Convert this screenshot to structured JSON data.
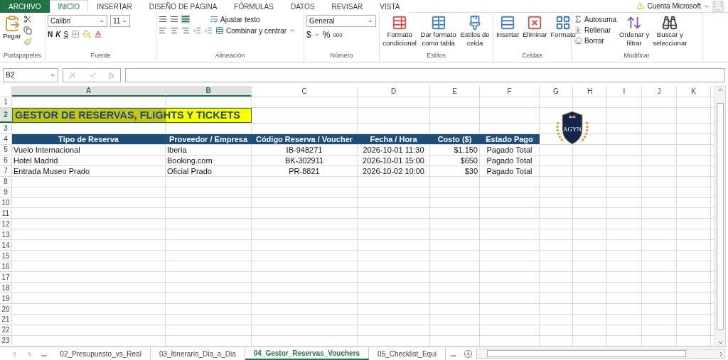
{
  "ribbon_tabs": [
    {
      "label": "ARCHIVO",
      "kind": "file",
      "selected": false
    },
    {
      "label": "INICIO",
      "kind": "tab",
      "selected": true
    },
    {
      "label": "INSERTAR",
      "kind": "tab",
      "selected": false
    },
    {
      "label": "DISEÑO DE PÁGINA",
      "kind": "tab",
      "selected": false
    },
    {
      "label": "FÓRMULAS",
      "kind": "tab",
      "selected": false
    },
    {
      "label": "DATOS",
      "kind": "tab",
      "selected": false
    },
    {
      "label": "REVISAR",
      "kind": "tab",
      "selected": false
    },
    {
      "label": "VISTA",
      "kind": "tab",
      "selected": false
    }
  ],
  "account": "Cuenta Microsoft",
  "ribbon": {
    "clipboard": {
      "paste": "Pegar",
      "label": "Portapapeles"
    },
    "font": {
      "name": "Calibri",
      "size": "11",
      "bold": "N",
      "italic": "K",
      "underline": "S",
      "label": "Fuente"
    },
    "alignment": {
      "wrap": "Ajustar texto",
      "merge": "Combinar y centrar",
      "label": "Alineación"
    },
    "number": {
      "format": "General",
      "currency": "$",
      "percent": "%",
      "thousands": "000",
      "label": "Número"
    },
    "styles": {
      "buttons": [
        [
          "Formato",
          "condicional"
        ],
        [
          "Dar formato",
          "como tabla"
        ],
        [
          "Estilos de",
          "celda"
        ]
      ],
      "label": "Estilos"
    },
    "cells": {
      "buttons": [
        "Insertar",
        "Eliminar",
        "Formato"
      ],
      "label": "Celdas"
    },
    "editing": {
      "autosum": "Autosuma",
      "fill": "Rellenar",
      "clear": "Borrar",
      "sort": [
        "Ordenar y",
        "filtrar"
      ],
      "find": [
        "Buscar y",
        "seleccionar"
      ],
      "label": "Modificar"
    }
  },
  "name_box": "B2",
  "function_symbol": "fx",
  "columns": [
    {
      "label": "A",
      "selected": true
    },
    {
      "label": "B",
      "selected": true
    },
    {
      "label": "C",
      "selected": false
    },
    {
      "label": "D",
      "selected": false
    },
    {
      "label": "E",
      "selected": false
    },
    {
      "label": "F",
      "selected": false
    },
    {
      "label": "G",
      "selected": false
    },
    {
      "label": "H",
      "selected": false
    },
    {
      "label": "I",
      "selected": false
    },
    {
      "label": "J",
      "selected": false
    },
    {
      "label": "K",
      "selected": false
    }
  ],
  "row_numbers": [
    {
      "label": "1",
      "selected": false
    },
    {
      "label": "2",
      "selected": true
    },
    {
      "label": "3",
      "selected": false
    },
    {
      "label": "4",
      "selected": false
    },
    {
      "label": "5",
      "selected": false
    },
    {
      "label": "6",
      "selected": false
    },
    {
      "label": "7",
      "selected": false
    },
    {
      "label": "8",
      "selected": false
    },
    {
      "label": "9",
      "selected": false
    },
    {
      "label": "10",
      "selected": false
    },
    {
      "label": "11",
      "selected": false
    },
    {
      "label": "12",
      "selected": false
    },
    {
      "label": "13",
      "selected": false
    },
    {
      "label": "14",
      "selected": false
    },
    {
      "label": "15",
      "selected": false
    },
    {
      "label": "16",
      "selected": false
    },
    {
      "label": "17",
      "selected": false
    },
    {
      "label": "18",
      "selected": false
    },
    {
      "label": "19",
      "selected": false
    },
    {
      "label": "20",
      "selected": false
    },
    {
      "label": "21",
      "selected": false
    },
    {
      "label": "22",
      "selected": false
    },
    {
      "label": "23",
      "selected": false
    }
  ],
  "title": "GESTOR DE RESERVAS, FLIGHTS Y TICKETS",
  "table": {
    "columns": [
      "Tipo de Reserva",
      "Proveedor / Empresa",
      "Código Reserva / Voucher",
      "Fecha / Hora",
      "Costo ($)",
      "Estado Pago"
    ],
    "rows": [
      [
        "Vuelo Internacional",
        "Iberia",
        "IB-948271",
        "2026-10-01 11:30",
        "$1.150",
        "Pagado Total"
      ],
      [
        "Hotel Madrid",
        "Booking.com",
        "BK-302911",
        "2026-10-01 15:00",
        "$650",
        "Pagado Total"
      ],
      [
        "Entrada Museo Prado",
        "Oficial Prado",
        "PR-8821",
        "2026-10-02 10:00",
        "$30",
        "Pagado Total"
      ]
    ]
  },
  "logo": {
    "text": "AGYN"
  },
  "sheet_tabs": {
    "more_before": "...",
    "tabs": [
      {
        "label": "02_Presupuesto_vs_Real",
        "selected": false
      },
      {
        "label": "03_Itinerario_Dia_a_Dia",
        "selected": false
      },
      {
        "label": "04_Gestor_Reservas_Vouchers",
        "selected": true
      },
      {
        "label": "05_Checklist_Equi",
        "selected": false
      }
    ],
    "more_after": "..."
  }
}
